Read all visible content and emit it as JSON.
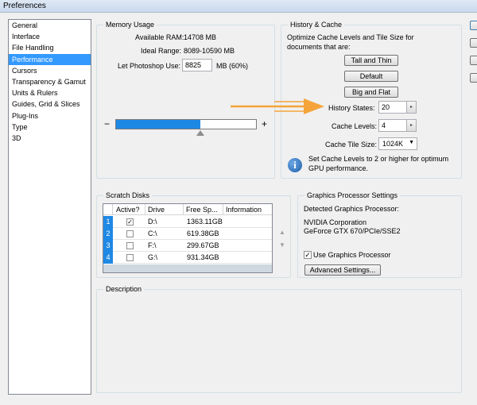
{
  "window": {
    "title": "Preferences"
  },
  "sidebar": {
    "items": [
      {
        "label": "General"
      },
      {
        "label": "Interface"
      },
      {
        "label": "File Handling"
      },
      {
        "label": "Performance",
        "selected": true
      },
      {
        "label": "Cursors"
      },
      {
        "label": "Transparency & Gamut"
      },
      {
        "label": "Units & Rulers"
      },
      {
        "label": "Guides, Grid & Slices"
      },
      {
        "label": "Plug-Ins"
      },
      {
        "label": "Type"
      },
      {
        "label": "3D"
      }
    ]
  },
  "memory": {
    "title": "Memory Usage",
    "available_label": "Available RAM:",
    "available_value": "14708 MB",
    "ideal_label": "Ideal Range:",
    "ideal_value": "8089-10590 MB",
    "let_label": "Let Photoshop Use:",
    "let_value": "8825",
    "let_unit": "MB (60%)",
    "minus": "−",
    "plus": "+",
    "slider_fraction": 0.6
  },
  "history": {
    "title": "History & Cache",
    "desc": "Optimize Cache Levels and Tile Size for documents that are:",
    "btn_tall": "Tall and Thin",
    "btn_default": "Default",
    "btn_big": "Big and Flat",
    "history_states_label": "History States:",
    "history_states_value": "20",
    "cache_levels_label": "Cache Levels:",
    "cache_levels_value": "4",
    "tile_size_label": "Cache Tile Size:",
    "tile_size_value": "1024K",
    "note": "Set Cache Levels to 2 or higher for optimum GPU performance.",
    "info_glyph": "i"
  },
  "scratch": {
    "title": "Scratch Disks",
    "columns": [
      "Active?",
      "Drive",
      "Free Sp...",
      "Information"
    ],
    "rows": [
      {
        "num": "1",
        "active": "✓",
        "drive": "D:\\",
        "free": "1363.11GB"
      },
      {
        "num": "2",
        "active": "",
        "drive": "C:\\",
        "free": "619.38GB"
      },
      {
        "num": "3",
        "active": "",
        "drive": "F:\\",
        "free": "299.67GB"
      },
      {
        "num": "4",
        "active": "",
        "drive": "G:\\",
        "free": "931.34GB"
      }
    ],
    "up": "▲",
    "down": "▼"
  },
  "gpu": {
    "title": "Graphics Processor Settings",
    "detected_label": "Detected Graphics Processor:",
    "vendor": "NVIDIA Corporation",
    "model": "GeForce GTX 670/PCIe/SSE2",
    "use_label": "Use Graphics Processor",
    "use_checked": "✓",
    "advanced_btn": "Advanced Settings..."
  },
  "description": {
    "title": "Description"
  },
  "colors": {
    "accent": "#1e88e5",
    "selection": "#3399ff",
    "annotation_arrow": "#f4a43a"
  }
}
